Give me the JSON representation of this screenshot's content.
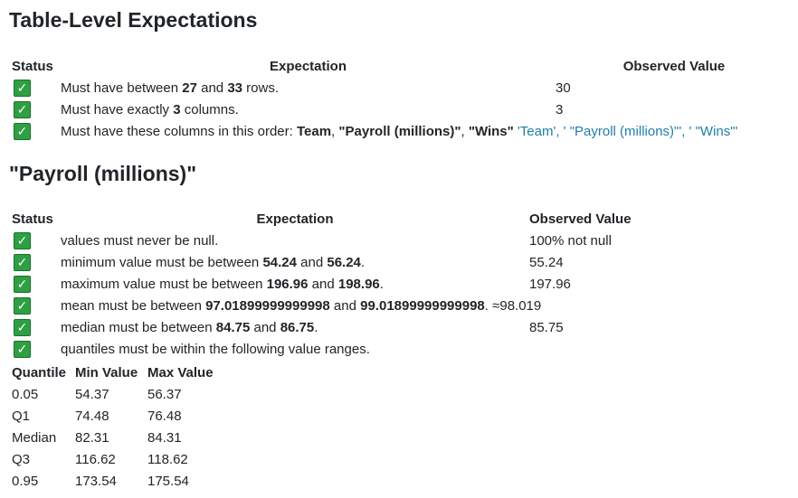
{
  "section1": {
    "title": "Table-Level Expectations",
    "headers": {
      "status": "Status",
      "expectation": "Expectation",
      "observed": "Observed Value"
    },
    "row1": {
      "pre": "Must have between ",
      "b1": "27",
      "mid": " and ",
      "b2": "33",
      "post": " rows.",
      "observed": "30"
    },
    "row2": {
      "pre": "Must have exactly ",
      "b1": "3",
      "post": " columns.",
      "observed": "3"
    },
    "row3": {
      "pre": "Must have these columns in this order: ",
      "b1": "Team",
      "sep1": ", ",
      "b2": "\"Payroll (millions)\"",
      "sep2": ", ",
      "b3": "\"Wins\"",
      "observed": " 'Team', ' \"Payroll (millions)\"', ' \"Wins\"'"
    }
  },
  "section2": {
    "title": "\"Payroll (millions)\"",
    "headers": {
      "status": "Status",
      "expectation": "Expectation",
      "observed": "Observed Value"
    },
    "row1": {
      "text": "values must never be null.",
      "observed": "100% not null"
    },
    "row2": {
      "pre": "minimum value must be between ",
      "b1": "54.24",
      "mid": " and ",
      "b2": "56.24",
      "post": ".",
      "observed": "55.24"
    },
    "row3": {
      "pre": "maximum value must be between ",
      "b1": "196.96",
      "mid": " and ",
      "b2": "198.96",
      "post": ".",
      "observed": "197.96"
    },
    "row4": {
      "pre": "mean must be between ",
      "b1": "97.01899999999998",
      "mid": " and ",
      "b2": "99.01899999999998",
      "post": ".",
      "observed": " ≈98.019"
    },
    "row5": {
      "pre": "median must be between ",
      "b1": "84.75",
      "mid": " and ",
      "b2": "86.75",
      "post": ".",
      "observed": "85.75"
    },
    "row6": {
      "text": "quantiles must be within the following value ranges."
    }
  },
  "quantiles": {
    "headers": {
      "quantile": "Quantile",
      "min": "Min Value",
      "max": "Max Value"
    },
    "rows": [
      {
        "q": "0.05",
        "min": "54.37",
        "max": "56.37"
      },
      {
        "q": "Q1",
        "min": "74.48",
        "max": "76.48"
      },
      {
        "q": "Median",
        "min": "82.31",
        "max": "84.31"
      },
      {
        "q": "Q3",
        "min": "116.62",
        "max": "118.62"
      },
      {
        "q": "0.95",
        "min": "173.54",
        "max": "175.54"
      }
    ]
  }
}
